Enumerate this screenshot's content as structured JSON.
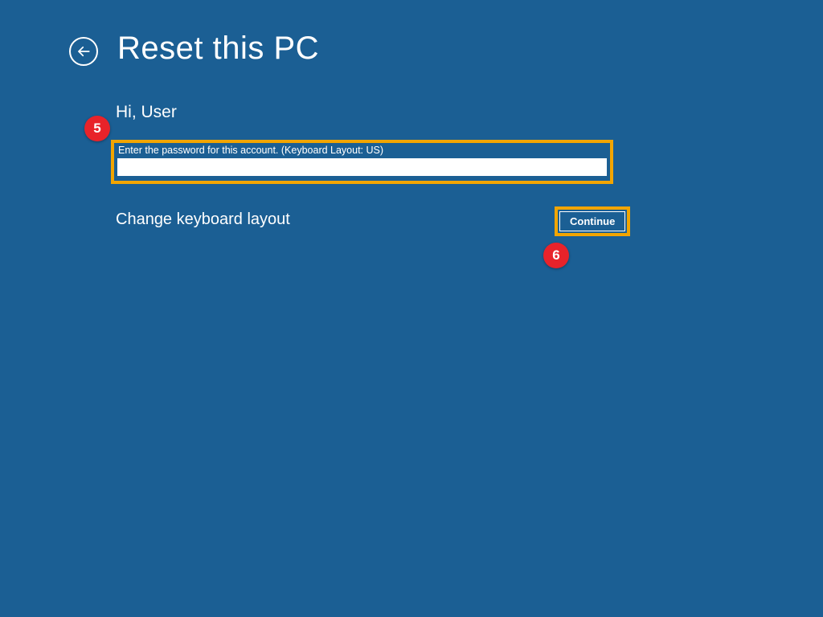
{
  "header": {
    "title": "Reset this PC"
  },
  "greeting": "Hi, User",
  "password": {
    "label": "Enter the password for this account. (Keyboard Layout: US)",
    "value": ""
  },
  "keyboard_link": "Change keyboard layout",
  "continue_label": "Continue",
  "callouts": {
    "five": "5",
    "six": "6"
  },
  "colors": {
    "background": "#1b5f94",
    "highlight": "#f2a500",
    "callout": "#e8232a"
  }
}
